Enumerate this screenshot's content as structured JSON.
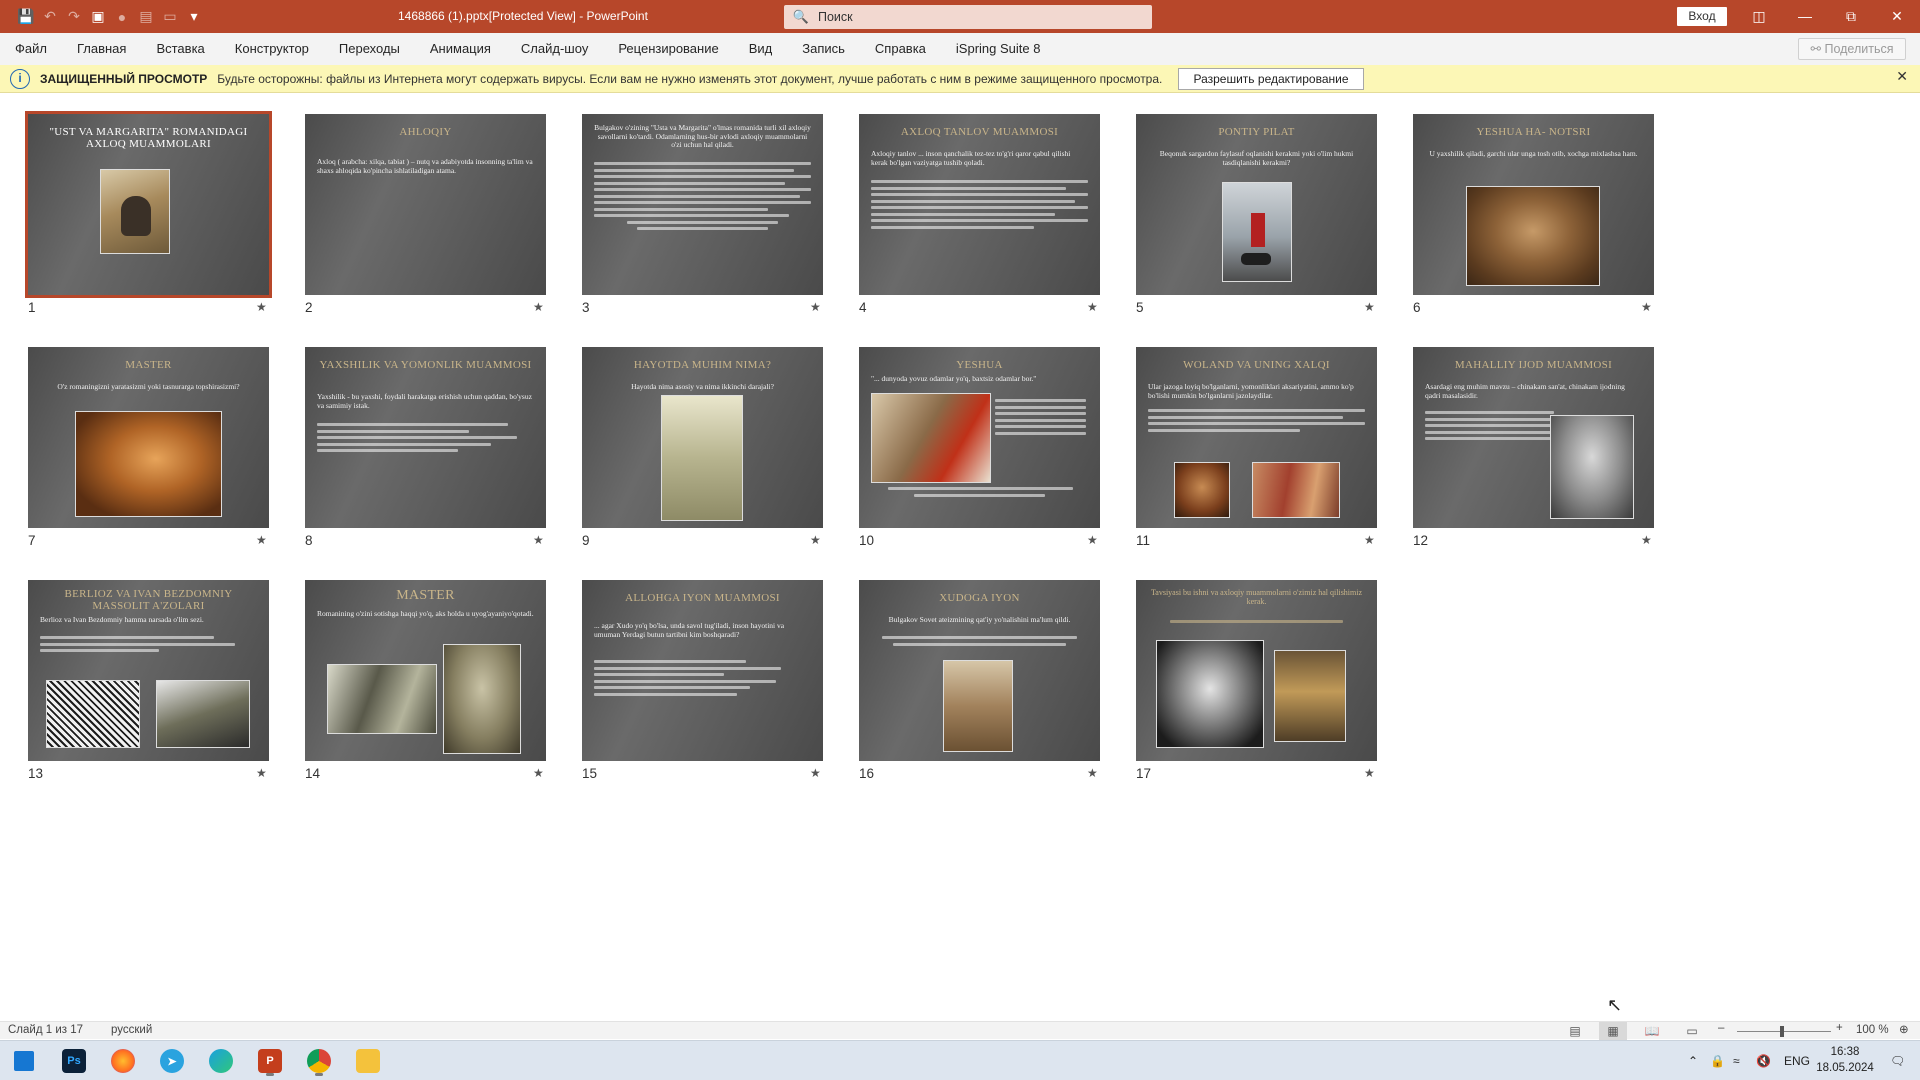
{
  "titlebar": {
    "doc_title": "1468866 (1).pptx[Protected View] - PowerPoint",
    "search_placeholder": "Поиск",
    "signin_label": "Вход",
    "accent": "#b7472a"
  },
  "menu": {
    "tabs": [
      "Файл",
      "Главная",
      "Вставка",
      "Конструктор",
      "Переходы",
      "Анимация",
      "Слайд-шоу",
      "Рецензирование",
      "Вид",
      "Запись",
      "Справка",
      "iSpring Suite 8"
    ],
    "share_label": "Поделиться"
  },
  "protected_view": {
    "title": "ЗАЩИЩЕННЫЙ ПРОСМОТР",
    "message": "Будьте осторожны: файлы из Интернета могут содержать вирусы. Если вам не нужно изменять этот документ, лучше работать с ним в режиме защищенного просмотра.",
    "enable_label": "Разрешить редактирование",
    "bg_color": "#fcf7b6"
  },
  "slides": [
    {
      "num": "1",
      "title": "\"UST VA MARGARITA\" ROMANIDAGI AXLOQ MUAMMOLARI",
      "selected": true
    },
    {
      "num": "2",
      "title": "AHLOQIY",
      "body": "Axloq ( arabcha: xilqa, tabiat ) – nutq va adabiyotda insonning ta'lim va shaxs ahloqida ko'pincha ishlatiladigan atama."
    },
    {
      "num": "3",
      "title": "",
      "body": "Bulgakov o'zining \"Usta va Margarita\" o'lmas romanida turli xil axloqiy savollarni ko'tardi. Odamlarning hus-bir avlodi axloqiy muammolarni o'zi uchun hal qiladi."
    },
    {
      "num": "4",
      "title": "AXLOQ TANLOV MUAMMOSI",
      "body": "Axloqiy tanlov ... inson qanchalik tez-tez to'g'ri qaror qabul qilishi kerak bo'lgan vaziyatga tushib qoladi."
    },
    {
      "num": "5",
      "title": "PONTIY PILAT",
      "body": "Beqonuk sargardon faylasuf oqlanishi kerakmi yoki o'lim hukmi tasdiqlanishi kerakmi?"
    },
    {
      "num": "6",
      "title": "YESHUA HA- NOTSRI",
      "body": "U yaxshilik qiladi, garchi ular unga tosh otib, xochga mixlashsa ham."
    },
    {
      "num": "7",
      "title": "MASTER",
      "body": "O'z romaningizni yaratasizmi yoki tasnurarga topshirasizmi?"
    },
    {
      "num": "8",
      "title": "YAXSHILIK VA YOMONLIK MUAMMOSI",
      "body": "Yaxshilik - bu yaxshi, foydali harakatga erishish uchun qaddan, bo'ysuz va samimiy istak."
    },
    {
      "num": "9",
      "title": "HAYOTDA MUHIM NIMA?",
      "body": "Hayotda nima asosiy va nima ikkinchi darajali?"
    },
    {
      "num": "10",
      "title": "YESHUA",
      "body": "\"... dunyoda yovuz odamlar yo'q, baxtsiz odamlar bor.\""
    },
    {
      "num": "11",
      "title": "WOLAND VA UNING XALQI",
      "body": "Ular jazoga loyiq bo'lganlarni, yomonliklari aksariyatini, ammo ko'p bo'lishi mumkin bo'lganlarni jazolaydilar."
    },
    {
      "num": "12",
      "title": "MAHALLIY IJOD MUAMMOSI",
      "body": "Asardagi eng muhim mavzu – chinakam san'at, chinakam ijodning qadri masalasidir."
    },
    {
      "num": "13",
      "title": "BERLIOZ VA IVAN BEZDOMNIY MASSOLIT A'ZOLARI",
      "body": "Berlioz va Ivan Bezdomniy hamma narsada o'lim sezi."
    },
    {
      "num": "14",
      "title": "MASTER",
      "body": "Romanining o'zini sotishga haqqi yo'q, aks holda u uyog'ayaniyo'qotadi."
    },
    {
      "num": "15",
      "title": "ALLOHGA IYON MUAMMOSI",
      "body": "... agar Xudo yo'q bo'lsa, unda savol tug'iladi, inson hayotini va umuman Yerdagi butun tartibni kim boshqaradi?"
    },
    {
      "num": "16",
      "title": "XUDOGA IYON",
      "body": "Bulgakov Sovet ateizmining qat'iy yo'nalishini ma'lum qildi."
    },
    {
      "num": "17",
      "title": "",
      "body": "Tavsiyasi bu ishni va axloqiy muammolarni o'zimiz hal qilishimiz kerak."
    }
  ],
  "statusbar": {
    "slide_info": "Слайд 1 из 17",
    "language": "русский",
    "zoom": "100 %"
  },
  "taskbar": {
    "apps": [
      "windows-start",
      "photoshop",
      "firefox",
      "telegram",
      "edge",
      "powerpoint",
      "chrome",
      "file-explorer"
    ],
    "lang": "ENG",
    "time": "16:38",
    "date": "18.05.2024"
  }
}
